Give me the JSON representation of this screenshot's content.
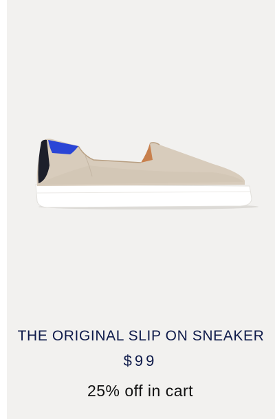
{
  "product": {
    "image_icon": "slip-on-sneaker-image",
    "name": "THE ORIGINAL SLIP ON SNEAKER",
    "price": "$99",
    "promo": "25% off in cart"
  },
  "colors": {
    "background": "#f2f1ef",
    "title": "#0e1a4a",
    "shoe_upper": "#d8ccbc",
    "heel_accent": "#2a45d6",
    "sole": "#ffffff"
  }
}
